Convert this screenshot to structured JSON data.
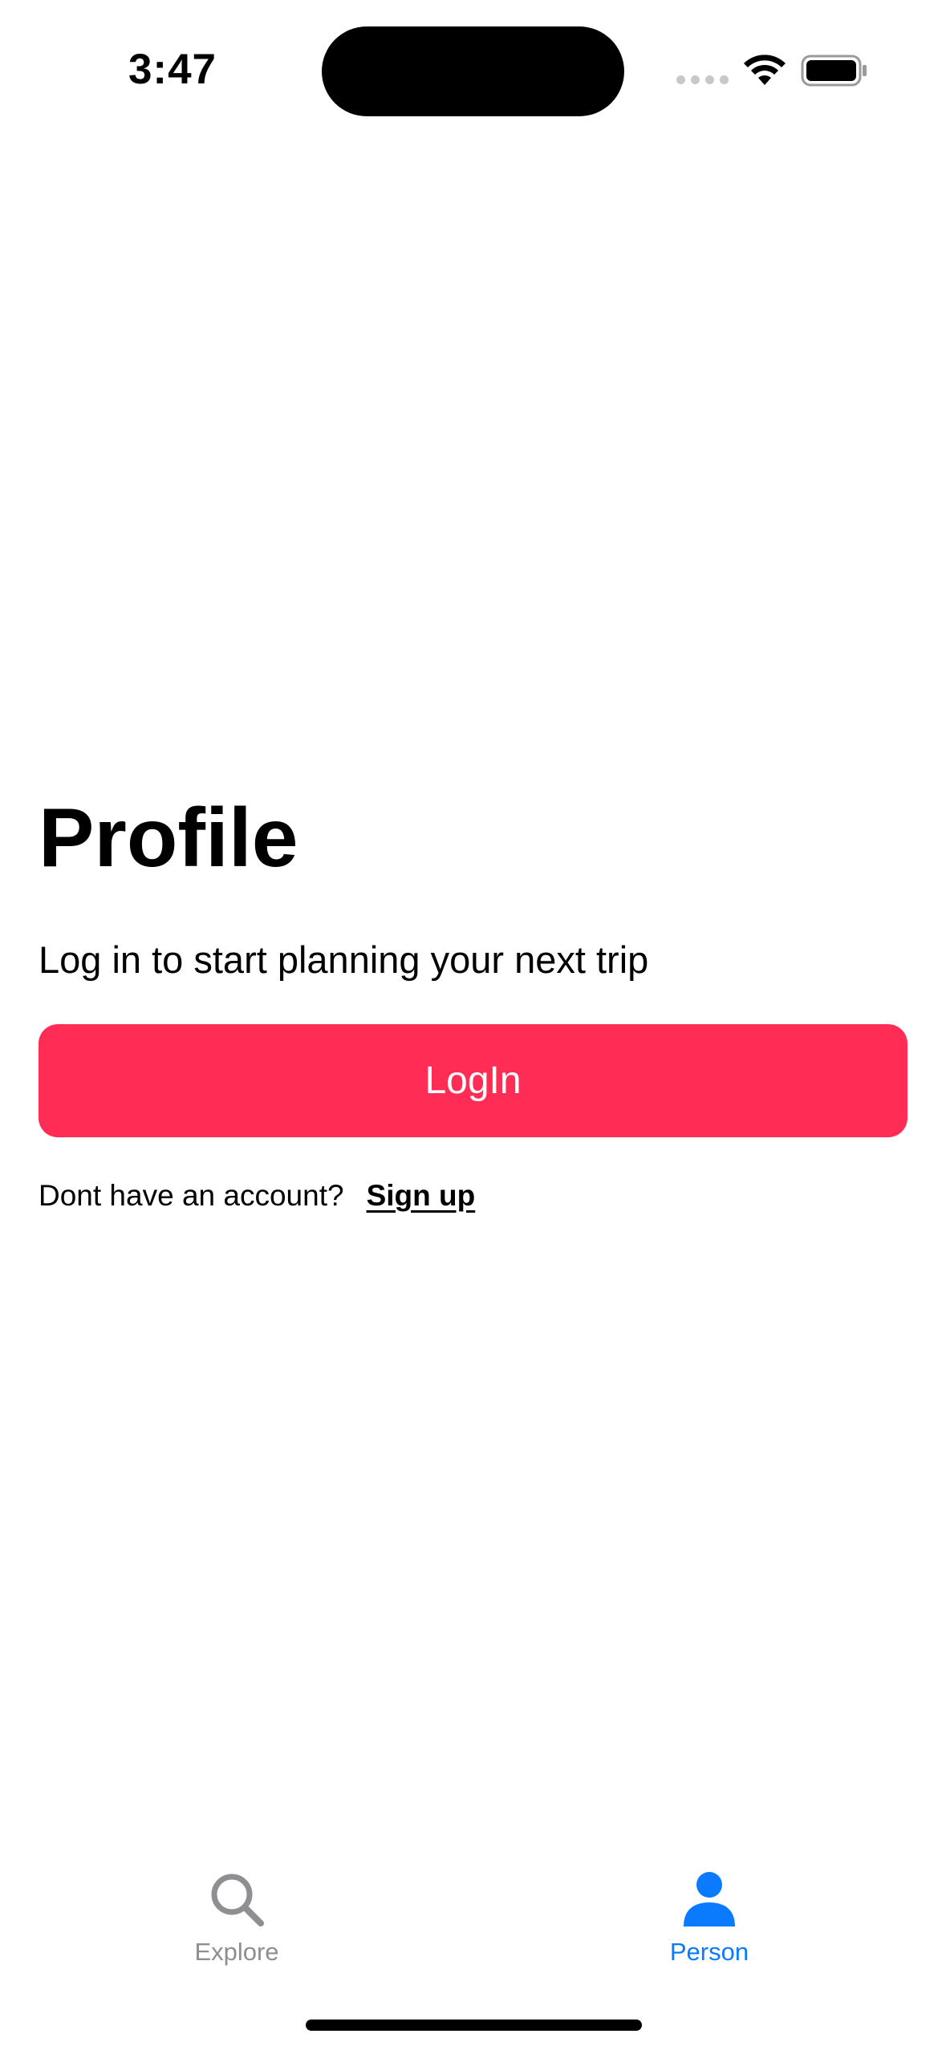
{
  "status_bar": {
    "time": "3:47",
    "icons": [
      "cellular-signal-icon",
      "wifi-icon",
      "battery-icon"
    ]
  },
  "profile": {
    "title": "Profile",
    "subtitle": "Log in to start planning your next trip",
    "login_label": "LogIn",
    "signup_prompt": "Dont have an account?",
    "signup_label": "Sign up"
  },
  "tab_bar": {
    "items": [
      {
        "label": "Explore",
        "icon": "search-icon",
        "selected": false
      },
      {
        "label": "Person",
        "icon": "person-icon",
        "selected": true
      }
    ]
  },
  "colors": {
    "accent": "#ff2d55",
    "tab_selected": "#0a7bff",
    "tab_unselected": "#8e8e93"
  }
}
